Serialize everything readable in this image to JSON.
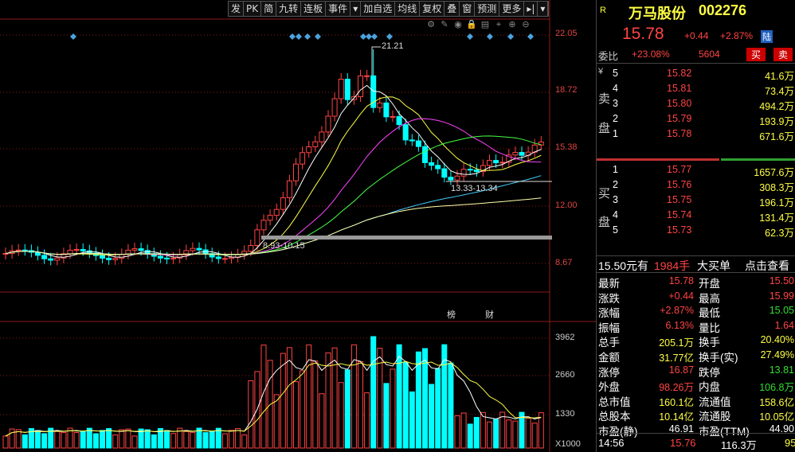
{
  "toolbar": [
    "发",
    "PK",
    "简",
    "九转",
    "连板",
    "事件",
    "▾",
    "加自选",
    "均线",
    "复权",
    "叠",
    "窗",
    "预测",
    "更多",
    "▸|",
    "▾"
  ],
  "tool_icons": [
    "settings-icon",
    "pen-icon",
    "eye-icon",
    "lock-icon",
    "clipboard-icon",
    "pin-icon",
    "zoom-in-icon",
    "zoom-out-icon"
  ],
  "price_axis": [
    "22.05",
    "18.72",
    "15.38",
    "12.00",
    "8.67"
  ],
  "vol_axis": [
    "3962",
    "2660",
    "1330",
    "X1000"
  ],
  "annotations": {
    "high": "21.21",
    "low_range": "8.93-10.15",
    "mid_range": "13.33-13.34",
    "marker1": "榜",
    "marker2": "财"
  },
  "stock": {
    "badge": "R",
    "name": "万马股份",
    "code": "002276",
    "price": "15.78",
    "change": "+0.44",
    "pct": "+2.87%",
    "tag": "陆"
  },
  "commission": {
    "label": "委比",
    "ratio": "+23.08%",
    "diff": "5604",
    "buy": "买",
    "sell": "卖"
  },
  "ask_side": {
    "label1": "卖",
    "label2": "盘",
    "yen": "¥",
    "rows": [
      [
        "5",
        "15.82",
        "41.6万"
      ],
      [
        "4",
        "15.81",
        "73.4万"
      ],
      [
        "3",
        "15.80",
        "494.2万"
      ],
      [
        "2",
        "15.79",
        "193.9万"
      ],
      [
        "1",
        "15.78",
        "671.6万"
      ]
    ]
  },
  "bid_side": {
    "label1": "买",
    "label2": "盘",
    "rows": [
      [
        "1",
        "15.77",
        "1657.6万"
      ],
      [
        "2",
        "15.76",
        "308.3万"
      ],
      [
        "3",
        "15.75",
        "196.1万"
      ],
      [
        "4",
        "15.74",
        "131.4万"
      ],
      [
        "5",
        "15.73",
        "62.3万"
      ]
    ]
  },
  "big_order": {
    "price": "15.50元有",
    "qty": "1984手",
    "type": "大买单",
    "link": "点击查看"
  },
  "stats": [
    [
      "最新",
      "15.78",
      "开盘",
      "15.50"
    ],
    [
      "涨跌",
      "+0.44",
      "最高",
      "15.99"
    ],
    [
      "涨幅",
      "+2.87%",
      "最低",
      "15.05"
    ],
    [
      "振幅",
      "6.13%",
      "量比",
      "1.64"
    ],
    [
      "总手",
      "205.1万",
      "换手",
      "20.40%"
    ],
    [
      "金额",
      "31.77亿",
      "换手(实)",
      "27.49%"
    ],
    [
      "涨停",
      "16.87",
      "跌停",
      "13.81"
    ],
    [
      "外盘",
      "98.26万",
      "内盘",
      "106.8万"
    ],
    [
      "总市值",
      "160.1亿",
      "流通值",
      "158.6亿"
    ],
    [
      "总股本",
      "10.14亿",
      "流通股",
      "10.05亿"
    ],
    [
      "市盈(静)",
      "46.91",
      "市盈(TTM)",
      "44.90"
    ]
  ],
  "tick": {
    "time": "14:56",
    "price": "15.76",
    "vol": "116.3万",
    "extra": "95"
  },
  "colors": {
    "up": "#ff4444",
    "down": "#00ffff",
    "title": "#ffff44"
  }
}
